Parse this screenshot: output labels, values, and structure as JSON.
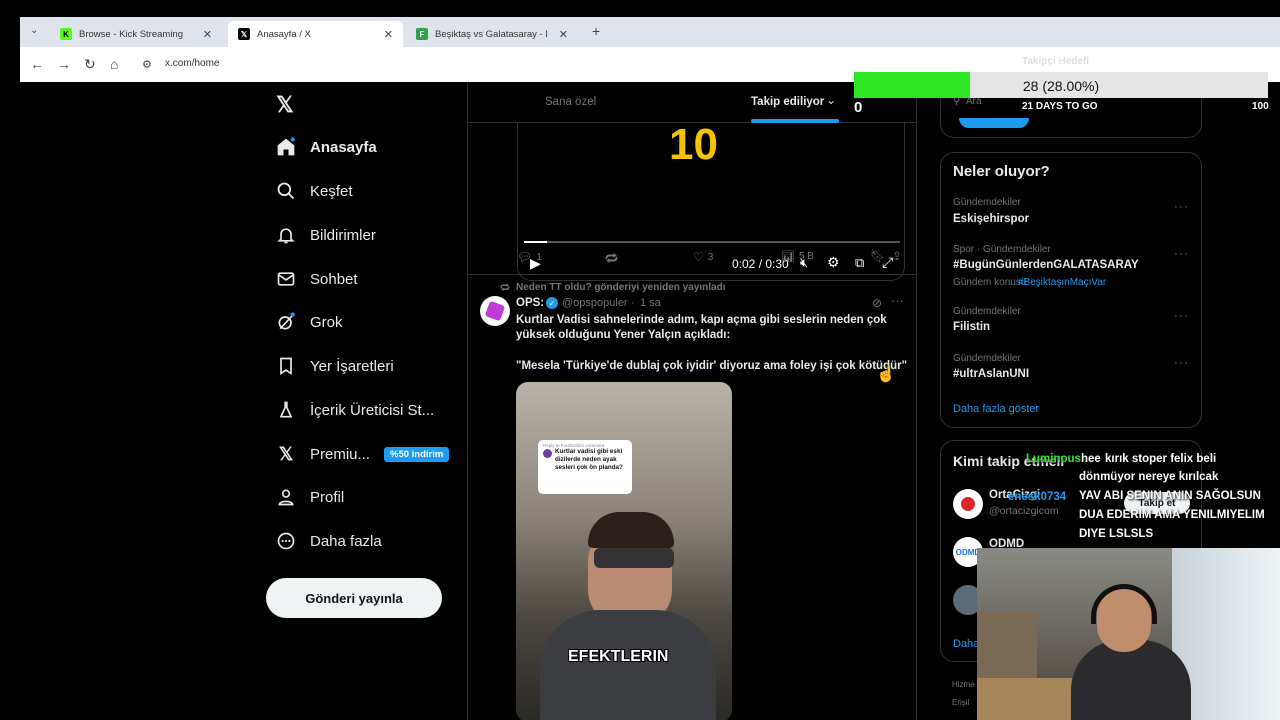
{
  "browser": {
    "tabs": [
      {
        "title": "Browse - Kick Streaming",
        "favicon": "kick-icon"
      },
      {
        "title": "Anasayfa / X",
        "favicon": "x-logo-icon"
      },
      {
        "title": "Beşiktaş vs Galatasaray - live sc",
        "favicon": "flashscore-icon"
      }
    ],
    "url": "x.com/home"
  },
  "nav": {
    "items": [
      {
        "label": "Anasayfa",
        "icon": "home-icon"
      },
      {
        "label": "Keşfet",
        "icon": "search-icon"
      },
      {
        "label": "Bildirimler",
        "icon": "bell-icon"
      },
      {
        "label": "Sohbet",
        "icon": "mail-icon"
      },
      {
        "label": "Grok",
        "icon": "grok-icon"
      },
      {
        "label": "Yer İşaretleri",
        "icon": "bookmark-icon"
      },
      {
        "label": "İçerik Üreticisi St...",
        "icon": "flask-icon"
      },
      {
        "label": "Premiu...",
        "icon": "x-logo-icon",
        "badge": "%50 indirim"
      },
      {
        "label": "Profil",
        "icon": "person-icon"
      },
      {
        "label": "Daha fazla",
        "icon": "more-circle-icon"
      }
    ],
    "post_button": "Gönderi yayınla"
  },
  "feed": {
    "tab_for_you": "Sana özel",
    "tab_following": "Takip ediliyor",
    "video": {
      "overlay_number": "10",
      "time": "0:02 / 0:30"
    },
    "post1_actions": {
      "replies": "1",
      "likes": "3",
      "views": "5 B"
    },
    "repost_note": "Neden TT oldu? gönderiyi yeniden yayınladı",
    "post2": {
      "author": "OPS:",
      "handle": "@opspopuler",
      "time": "1 sa",
      "text1": "Kurtlar Vadisi sahnelerinde adım, kapı açma gibi seslerin neden çok yüksek olduğunu Yener Yalçın açıkladı:",
      "text2": "\"Mesela 'Türkiye'de dublaj çok iyidir' diyoruz ama foley işi çok kötüdür\"",
      "image_caption": "EFEKTLERIN",
      "comment_reply": "Reply to FordSotilo's comment",
      "comment_text": "Kurtlar vadisi gibi eski dizilerde neden ayak sesleri çok ön planda?"
    }
  },
  "right": {
    "search_placeholder": "Ara",
    "trends_title": "Neler oluyor?",
    "trends": [
      {
        "meta": "Gündemdekiler",
        "name": "Eskişehirspor"
      },
      {
        "meta": "Spor · Gündemdekiler",
        "name": "#BugünGünlerdenGALATASARAY",
        "extra_prefix": "Gündem konusu",
        "extra_tag": "#BeşiktaşınMaçıVar"
      },
      {
        "meta": "Gündemdekiler",
        "name": "Filistin"
      },
      {
        "meta": "Gündemdekiler",
        "name": "#ultrAslanUNI"
      }
    ],
    "show_more": "Daha fazla göster",
    "who_to_follow": "Kimi takip etmeli",
    "suggestions": [
      {
        "name": "OrtaCizgi",
        "handle": "@ortacizgicom"
      },
      {
        "name": "ODMD",
        "handle": ""
      }
    ],
    "follow_label": "Takip et",
    "more_link": "Daha",
    "footer1": "Hizme",
    "footer2": "Erişil"
  },
  "stream_overlay": {
    "goal_title": "Takipçi Hedefi",
    "goal_text": "28 (28.00%)",
    "goal_progress": 0.28,
    "goal_days": "21 DAYS TO GO",
    "goal_start": "0",
    "goal_end": "100",
    "chat": {
      "user": "Luminous",
      "user_tag": "hee",
      "line1": "kırık stoper felix beli",
      "line2": "dönmüyor nereye kırılcak",
      "line3": "YAV ABI SENIN ANIN SAĞOLSUN",
      "line4": "DUA EDERIM AMA YENILMIYELIM",
      "line5": "DIYE LSLSLS",
      "overlay_user": "enesk0734"
    }
  },
  "colors": {
    "accent": "#1d9bf0",
    "goal_fill": "#2ee823",
    "kick_green": "#53fc18"
  }
}
